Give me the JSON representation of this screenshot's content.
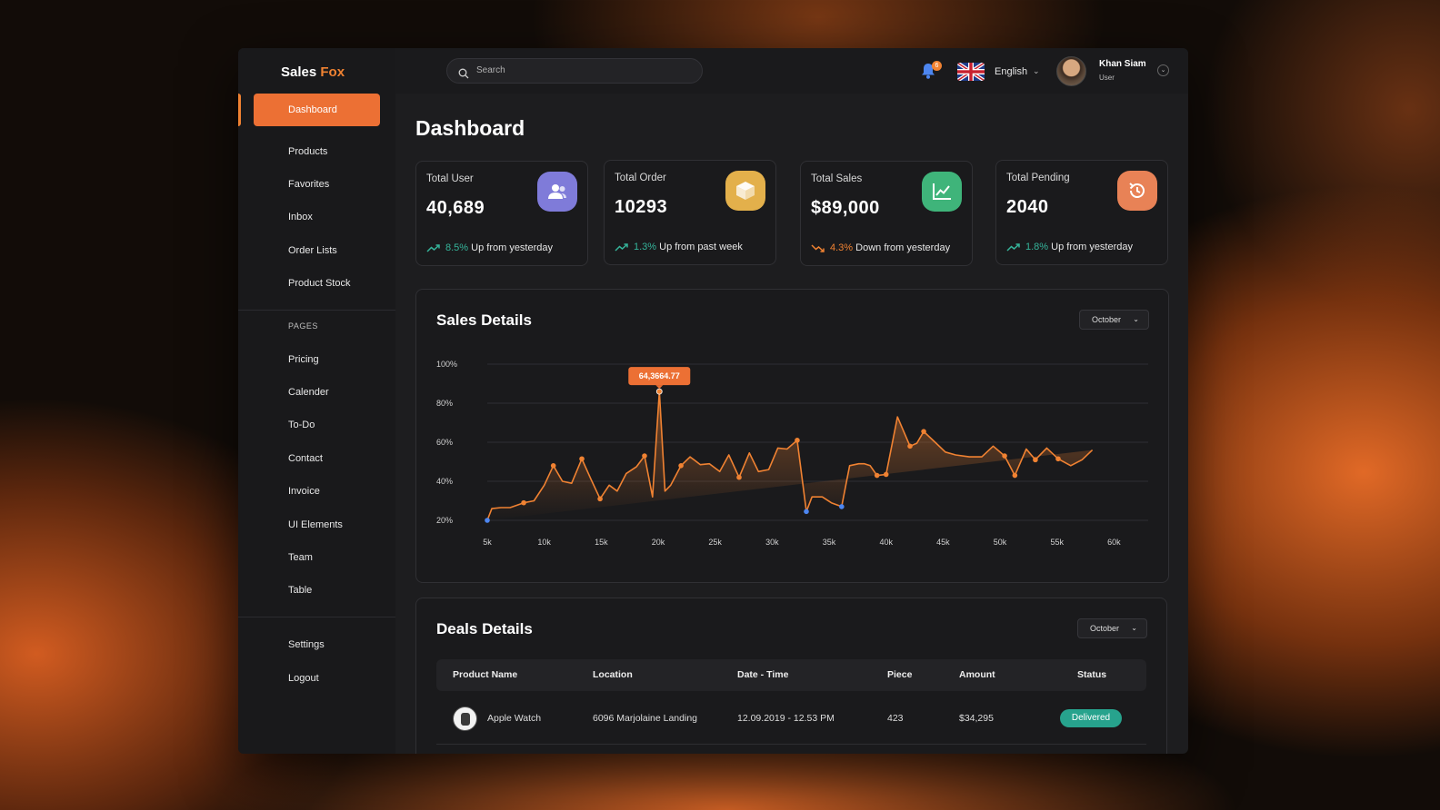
{
  "app": {
    "brand": {
      "part1": "Sales",
      "part2": "Fox"
    },
    "accent_color": "#f08232"
  },
  "sidebar": {
    "active": {
      "label": "Dashboard"
    },
    "main_items": [
      {
        "label": "Products"
      },
      {
        "label": "Favorites"
      },
      {
        "label": "Inbox"
      },
      {
        "label": "Order Lists"
      },
      {
        "label": "Product Stock"
      }
    ],
    "pages_title": "PAGES",
    "page_items": [
      {
        "label": "Pricing"
      },
      {
        "label": "Calender"
      },
      {
        "label": "To-Do"
      },
      {
        "label": "Contact"
      },
      {
        "label": "Invoice"
      },
      {
        "label": "UI Elements"
      },
      {
        "label": "Team"
      },
      {
        "label": "Table"
      }
    ],
    "bottom_items": [
      {
        "label": "Settings"
      },
      {
        "label": "Logout"
      }
    ]
  },
  "header": {
    "search_placeholder": "Search",
    "notification_count": "6",
    "language": "English",
    "user": {
      "name": "Khan Siam",
      "role": "User"
    }
  },
  "page": {
    "title": "Dashboard"
  },
  "stats": [
    {
      "label": "Total User",
      "value": "40,689",
      "pct": "8.5%",
      "trend_text": "Up from yesterday",
      "direction": "up",
      "icon": "users-icon",
      "icon_color": "#7f7bd9"
    },
    {
      "label": "Total Order",
      "value": "10293",
      "pct": "1.3%",
      "trend_text": "Up from past week",
      "direction": "up",
      "icon": "box-icon",
      "icon_color": "#e3b04b"
    },
    {
      "label": "Total Sales",
      "value": "$89,000",
      "pct": "4.3%",
      "trend_text": "Down from yesterday",
      "direction": "down",
      "icon": "line-chart-icon",
      "icon_color": "#3fb47a"
    },
    {
      "label": "Total Pending",
      "value": "2040",
      "pct": "1.8%",
      "trend_text": "Up from yesterday",
      "direction": "up",
      "icon": "history-icon",
      "icon_color": "#e88256"
    }
  ],
  "sales_details": {
    "title": "Sales Details",
    "month": "October",
    "tooltip": "64,3664.77"
  },
  "chart_data": {
    "type": "area",
    "title": "Sales Details",
    "xlabel": "",
    "ylabel": "",
    "x_ticks": [
      "5k",
      "10k",
      "15k",
      "20k",
      "25k",
      "30k",
      "35k",
      "40k",
      "45k",
      "50k",
      "55k",
      "60k"
    ],
    "y_ticks": [
      "20%",
      "40%",
      "60%",
      "80%",
      "100%"
    ],
    "xlim": [
      5000,
      63000
    ],
    "ylim": [
      20,
      100
    ],
    "grid": true,
    "series": [
      {
        "values_x": [
          5000,
          5400,
          6200,
          7000,
          8200,
          9100,
          10000,
          10800,
          11600,
          12400,
          13300,
          14100,
          14900,
          15700,
          16400,
          17200,
          18100,
          18800,
          19500,
          20100,
          20600,
          21100,
          22000,
          22800,
          23700,
          24500,
          25400,
          26200,
          27100,
          28000,
          28800,
          29700,
          30500,
          31300,
          32200,
          33000,
          33500,
          34400,
          35200,
          36100,
          36800,
          37600,
          38100,
          38600,
          39200,
          40000,
          41000,
          42100,
          42700,
          43300,
          44300,
          45200,
          46100,
          47300,
          48400,
          49400,
          50400,
          51300,
          52300,
          53100,
          54100,
          55100,
          56200,
          57200,
          58100,
          59000,
          59900,
          60800,
          61700,
          62800
        ],
        "values_y": [
          20,
          26,
          26.5,
          26.5,
          29,
          30,
          38,
          48,
          40,
          39,
          51.5,
          41,
          31,
          38,
          35,
          44,
          47.5,
          53,
          32,
          86,
          35,
          38,
          48,
          52.5,
          48.5,
          49,
          45,
          53.5,
          42,
          54.5,
          45,
          46,
          57,
          56.5,
          61,
          24.5,
          32,
          32,
          29,
          27,
          48,
          49,
          49,
          48,
          43,
          43.5,
          73,
          58,
          59.5,
          65.5,
          60,
          55,
          53.5,
          52.5,
          52.5,
          58,
          53,
          43,
          56.5,
          51,
          57,
          51.5,
          48,
          51,
          56
        ]
      }
    ],
    "highlight": {
      "x": 20100,
      "y": 86,
      "label": "64,3664.77"
    }
  },
  "deals_details": {
    "title": "Deals Details",
    "month": "October",
    "columns": [
      "Product Name",
      "Location",
      "Date - Time",
      "Piece",
      "Amount",
      "Status"
    ],
    "rows": [
      {
        "product": "Apple Watch",
        "location": "6096 Marjolaine Landing",
        "datetime": "12.09.2019 - 12.53 PM",
        "piece": "423",
        "amount": "$34,295",
        "status": "Delivered"
      }
    ]
  }
}
